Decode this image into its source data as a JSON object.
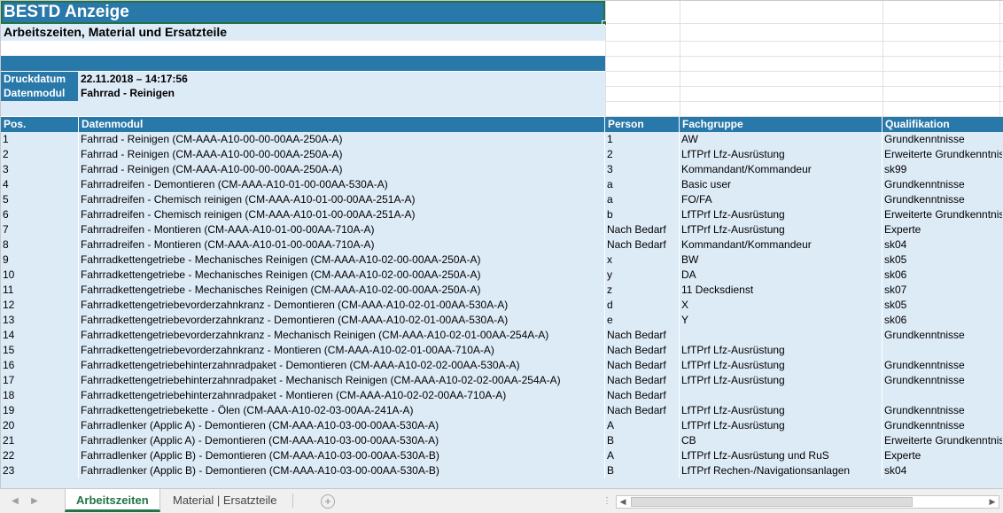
{
  "title": "BESTD Anzeige",
  "subtitle": "Arbeitszeiten, Material und Ersatzteile",
  "meta": [
    {
      "label": "Druckdatum",
      "value": "22.11.2018 – 14:17:56"
    },
    {
      "label": "Datenmodul",
      "value": "Fahrrad - Reinigen"
    }
  ],
  "columns": [
    "Pos.",
    "Datenmodul",
    "Person",
    "Fachgruppe",
    "Qualifikation"
  ],
  "rows": [
    [
      "1",
      "Fahrrad - Reinigen (CM-AAA-A10-00-00-00AA-250A-A)",
      "1",
      "AW",
      "Grundkenntnisse"
    ],
    [
      "2",
      "Fahrrad - Reinigen (CM-AAA-A10-00-00-00AA-250A-A)",
      "2",
      "LfTPrf Lfz-Ausrüstung",
      "Erweiterte Grundkenntnisse"
    ],
    [
      "3",
      "Fahrrad - Reinigen (CM-AAA-A10-00-00-00AA-250A-A)",
      "3",
      "Kommandant/Kommandeur",
      "sk99"
    ],
    [
      "4",
      "Fahrradreifen - Demontieren (CM-AAA-A10-01-00-00AA-530A-A)",
      "a",
      "Basic user",
      "Grundkenntnisse"
    ],
    [
      "5",
      "Fahrradreifen - Chemisch reinigen (CM-AAA-A10-01-00-00AA-251A-A)",
      "a",
      "FO/FA",
      "Grundkenntnisse"
    ],
    [
      "6",
      "Fahrradreifen - Chemisch reinigen (CM-AAA-A10-01-00-00AA-251A-A)",
      "b",
      "LfTPrf Lfz-Ausrüstung",
      "Erweiterte Grundkenntnisse"
    ],
    [
      "7",
      "Fahrradreifen - Montieren (CM-AAA-A10-01-00-00AA-710A-A)",
      "Nach Bedarf",
      "LfTPrf Lfz-Ausrüstung",
      "Experte"
    ],
    [
      "8",
      "Fahrradreifen - Montieren (CM-AAA-A10-01-00-00AA-710A-A)",
      "Nach Bedarf",
      "Kommandant/Kommandeur",
      "sk04"
    ],
    [
      "9",
      "Fahrradkettengetriebe - Mechanisches Reinigen (CM-AAA-A10-02-00-00AA-250A-A)",
      "x",
      "BW",
      "sk05"
    ],
    [
      "10",
      "Fahrradkettengetriebe - Mechanisches Reinigen (CM-AAA-A10-02-00-00AA-250A-A)",
      "y",
      "DA",
      "sk06"
    ],
    [
      "11",
      "Fahrradkettengetriebe - Mechanisches Reinigen (CM-AAA-A10-02-00-00AA-250A-A)",
      "z",
      "11 Decksdienst",
      "sk07"
    ],
    [
      "12",
      "Fahrradkettengetriebevorderzahnkranz - Demontieren (CM-AAA-A10-02-01-00AA-530A-A)",
      "d",
      "X",
      "sk05"
    ],
    [
      "13",
      "Fahrradkettengetriebevorderzahnkranz - Demontieren (CM-AAA-A10-02-01-00AA-530A-A)",
      "e",
      "Y",
      "sk06"
    ],
    [
      "14",
      "Fahrradkettengetriebevorderzahnkranz - Mechanisch Reinigen (CM-AAA-A10-02-01-00AA-254A-A)",
      "Nach Bedarf",
      "",
      "Grundkenntnisse"
    ],
    [
      "15",
      "Fahrradkettengetriebevorderzahnkranz - Montieren (CM-AAA-A10-02-01-00AA-710A-A)",
      "Nach Bedarf",
      "LfTPrf Lfz-Ausrüstung",
      ""
    ],
    [
      "16",
      "Fahrradkettengetriebehinterzahnradpaket - Demontieren (CM-AAA-A10-02-02-00AA-530A-A)",
      "Nach Bedarf",
      "LfTPrf Lfz-Ausrüstung",
      "Grundkenntnisse"
    ],
    [
      "17",
      "Fahrradkettengetriebehinterzahnradpaket - Mechanisch Reinigen (CM-AAA-A10-02-02-00AA-254A-A)",
      "Nach Bedarf",
      "LfTPrf Lfz-Ausrüstung",
      "Grundkenntnisse"
    ],
    [
      "18",
      "Fahrradkettengetriebehinterzahnradpaket - Montieren (CM-AAA-A10-02-02-00AA-710A-A)",
      "Nach Bedarf",
      "",
      ""
    ],
    [
      "19",
      "Fahrradkettengetriebekette - Ölen (CM-AAA-A10-02-03-00AA-241A-A)",
      "Nach Bedarf",
      "LfTPrf Lfz-Ausrüstung",
      "Grundkenntnisse"
    ],
    [
      "20",
      "Fahrradlenker (Applic A) - Demontieren (CM-AAA-A10-03-00-00AA-530A-A)",
      "A",
      "LfTPrf Lfz-Ausrüstung",
      "Grundkenntnisse"
    ],
    [
      "21",
      "Fahrradlenker (Applic A) - Demontieren (CM-AAA-A10-03-00-00AA-530A-A)",
      "B",
      "CB",
      "Erweiterte Grundkenntnisse"
    ],
    [
      "22",
      "Fahrradlenker (Applic B) - Demontieren (CM-AAA-A10-03-00-00AA-530A-B)",
      "A",
      "LfTPrf Lfz-Ausrüstung und RuS",
      "Experte"
    ],
    [
      "23",
      "Fahrradlenker (Applic B) - Demontieren (CM-AAA-A10-03-00-00AA-530A-B)",
      "B",
      "LfTPrf Rechen-/Navigationsanlagen",
      "sk04"
    ]
  ],
  "tabs": [
    {
      "label": "Arbeitszeiten",
      "active": true
    },
    {
      "label": "Material | Ersatzteile",
      "active": false
    }
  ],
  "icons": {
    "nav_prev": "chevron-left-icon",
    "nav_next": "chevron-right-icon",
    "add_sheet": "plus-circle-icon"
  },
  "colors": {
    "header_blue": "#2878a9",
    "row_fill": "#ddebf7",
    "accent_green": "#217346"
  }
}
